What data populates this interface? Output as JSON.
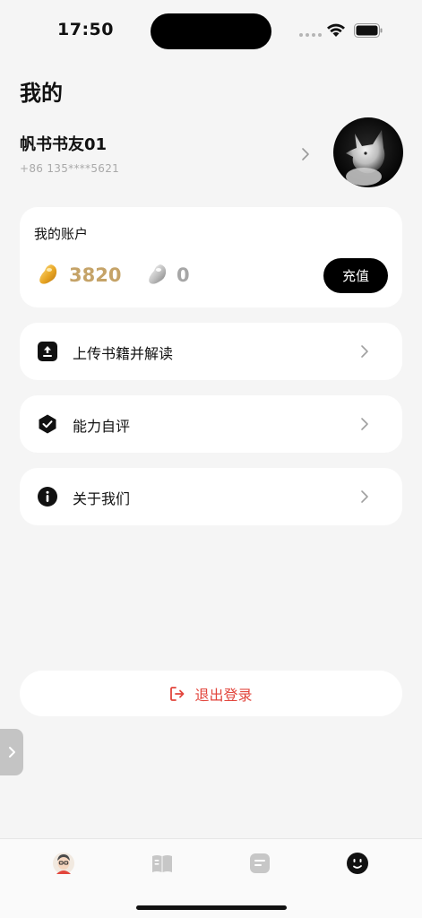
{
  "status_bar": {
    "time": "17:50",
    "wifi_icon": "wifi-icon",
    "battery_icon": "battery-icon"
  },
  "page": {
    "title": "我的"
  },
  "profile": {
    "nickname": "帆书书友01",
    "phone": "+86 135****5621",
    "avatar_icon": "fox-avatar"
  },
  "account": {
    "title": "我的账户",
    "gold_beans": "3820",
    "silver_beans": "0",
    "recharge_label": "充值",
    "gold_color": "#c5a368",
    "silver_color": "#a6a6a6"
  },
  "menu": [
    {
      "label": "上传书籍并解读",
      "icon": "upload-icon"
    },
    {
      "label": "能力自评",
      "icon": "hexagon-check-icon"
    },
    {
      "label": "关于我们",
      "icon": "info-icon"
    }
  ],
  "logout": {
    "label": "退出登录",
    "color": "#e2453c",
    "icon": "logout-icon"
  },
  "tab_bar": {
    "tabs": [
      {
        "icon": "avatar-tab-icon",
        "active": false
      },
      {
        "icon": "book-tab-icon",
        "active": false
      },
      {
        "icon": "notes-tab-icon",
        "active": false
      },
      {
        "icon": "smile-tab-icon",
        "active": true
      }
    ]
  }
}
